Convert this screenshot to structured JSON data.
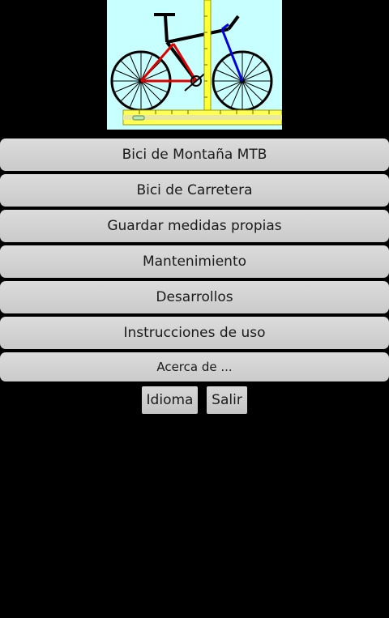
{
  "app": {
    "logo_icon": "bicycle-measurement-icon",
    "logo_bg": "#c8ffff"
  },
  "menu": {
    "items": [
      {
        "label": "Bici de Montaña MTB"
      },
      {
        "label": "Bici de Carretera"
      },
      {
        "label": "Guardar medidas propias"
      },
      {
        "label": "Mantenimiento"
      },
      {
        "label": "Desarrollos"
      },
      {
        "label": "Instrucciones de uso"
      },
      {
        "label": "Acerca de ..."
      }
    ]
  },
  "footer": {
    "language_label": "Idioma",
    "exit_label": "Salir"
  }
}
